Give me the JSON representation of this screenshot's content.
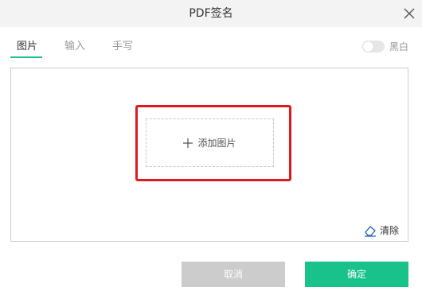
{
  "window": {
    "title": "PDF签名"
  },
  "tabs": [
    {
      "label": "图片",
      "active": true
    },
    {
      "label": "输入",
      "active": false
    },
    {
      "label": "手写",
      "active": false
    }
  ],
  "toggle": {
    "label": "黑白",
    "on": false
  },
  "canvas": {
    "add_label": "添加图片",
    "clear_label": "清除"
  },
  "buttons": {
    "cancel": "取消",
    "confirm": "确定"
  },
  "colors": {
    "accent": "#19c28b",
    "highlight": "#e0191f",
    "disabled": "#cccccc"
  }
}
